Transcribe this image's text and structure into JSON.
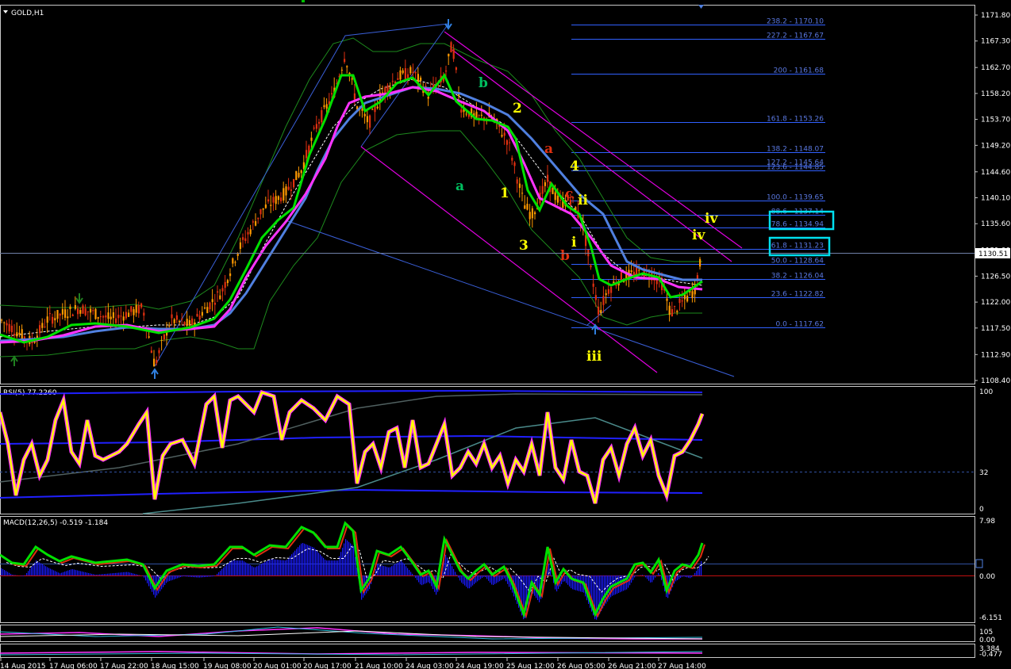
{
  "window_title": "GOLD,H1",
  "main": {
    "symbol_label": "GOLD,H1",
    "price_ticks": [
      "1171.80",
      "1167.30",
      "1162.70",
      "1158.20",
      "1153.70",
      "1149.20",
      "1144.60",
      "1140.10",
      "1135.60",
      "1131.00",
      "1126.50",
      "1122.00",
      "1117.50",
      "1112.90",
      "1108.40"
    ],
    "current_price": "1130.51",
    "fib_levels": [
      "238.2 - 1170.10",
      "227.2 - 1167.67",
      "200 - 1161.68",
      "161.8 - 1153.26",
      "138.2 - 1148.07",
      "127.2 - 1145.64",
      "123.6 - 1144.85",
      "100.0 - 1139.65",
      "88.6 - 1137.14",
      "78.6 - 1134.94",
      "61.8 - 1131.23",
      "50.0 - 1128.64",
      "38.2 - 1126.04",
      "23.6 - 1122.82",
      "0.0 - 1117.62"
    ],
    "wave_labels": [
      "a",
      "b",
      "1",
      "2",
      "3",
      "4",
      "a",
      "b",
      "c",
      "i",
      "ii",
      "iii",
      "iv",
      "iv"
    ]
  },
  "rsi": {
    "label": "RSI(5) 77.2260",
    "ticks": [
      "100",
      "32",
      "0"
    ]
  },
  "macd": {
    "label": "MACD(12,26,5) -0.519 -1.184",
    "ticks": [
      "7.98",
      "0.00",
      "-6.151"
    ]
  },
  "sub1": {
    "ticks": [
      "105",
      "0.00"
    ]
  },
  "sub2": {
    "ticks": [
      "3.384",
      "-0.477"
    ]
  },
  "time_axis": [
    "14 Aug 2015",
    "17 Aug 06:00",
    "17 Aug 22:00",
    "18 Aug 15:00",
    "19 Aug 08:00",
    "20 Aug 01:00",
    "20 Aug 17:00",
    "21 Aug 10:00",
    "24 Aug 03:00",
    "24 Aug 19:00",
    "25 Aug 12:00",
    "26 Aug 05:00",
    "26 Aug 21:00",
    "27 Aug 14:00"
  ],
  "colors": {
    "bull": "#ff9900",
    "bear": "#e03010",
    "ma_fast": "#00e000",
    "ma_mid": "#ff33ff",
    "ma_slow": "#5080e0",
    "fib": "#3060ff",
    "channel": "#e000e0",
    "highlight": "#00e0f0",
    "rsi": "#ffff00",
    "macd_hist": "#1a1aff"
  },
  "chart_data": {
    "type": "line",
    "title": "GOLD,H1",
    "ylim": [
      1108.4,
      1172.5
    ],
    "x": [
      "14 Aug 2015",
      "17 Aug 06:00",
      "17 Aug 22:00",
      "18 Aug 15:00",
      "19 Aug 08:00",
      "20 Aug 01:00",
      "20 Aug 17:00",
      "21 Aug 10:00",
      "24 Aug 03:00",
      "24 Aug 19:00",
      "25 Aug 12:00",
      "26 Aug 05:00",
      "26 Aug 21:00",
      "27 Aug 14:00"
    ],
    "series": [
      {
        "name": "GOLD,H1",
        "values": [
          1119,
          1120,
          1120.5,
          1117,
          1123,
          1139,
          1161,
          1158,
          1161,
          1154,
          1141,
          1119,
          1127,
          1130.5
        ]
      }
    ]
  }
}
